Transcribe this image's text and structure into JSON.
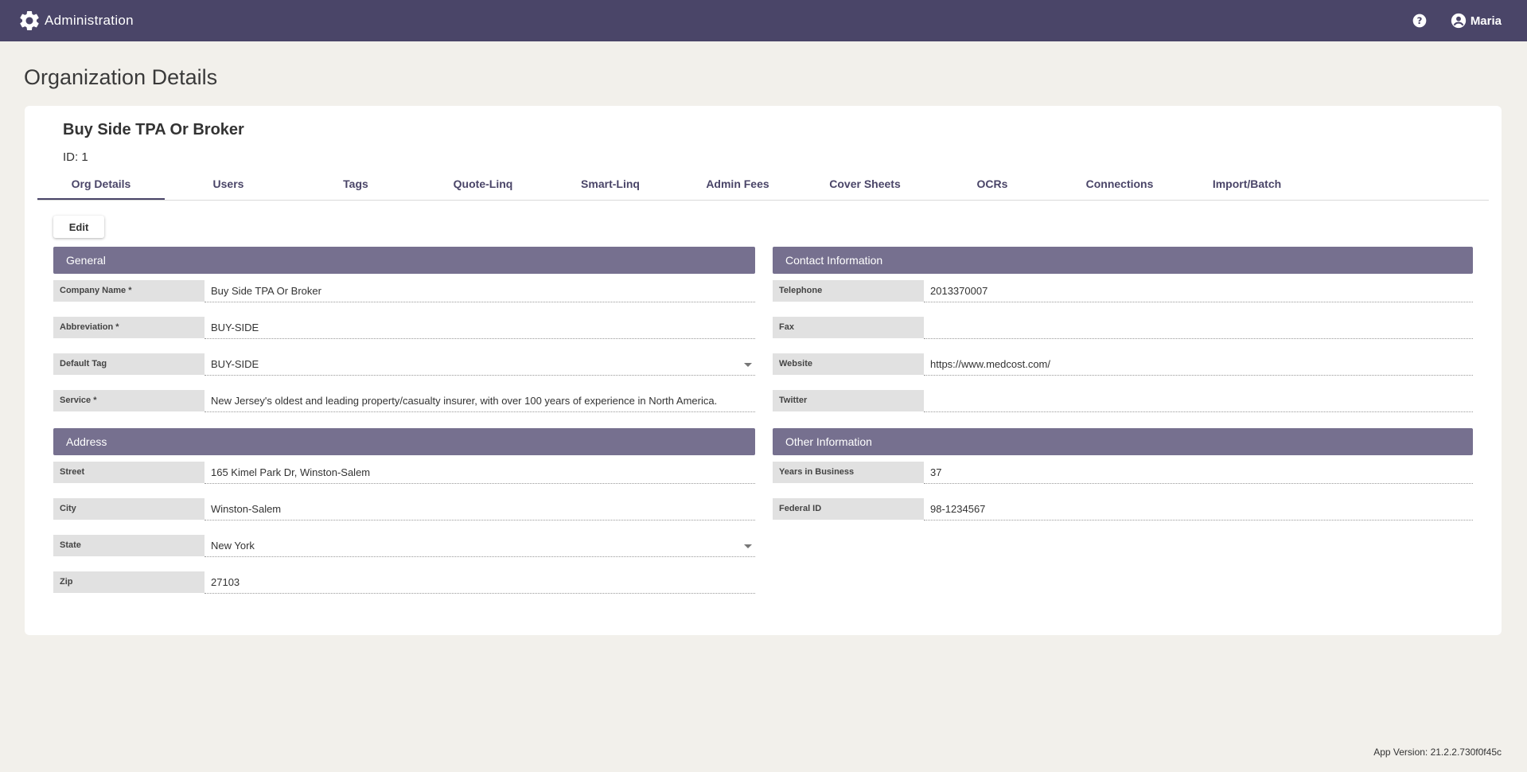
{
  "header": {
    "app_title": "Administration",
    "user_name": "Maria",
    "settings_icon": "gear-icon",
    "help_icon": "help-icon",
    "user_icon": "account-circle-icon",
    "bar_color": "#4a4568"
  },
  "page": {
    "title": "Organization Details",
    "org_name": "Buy Side TPA Or Broker",
    "id_label": "ID:",
    "id_value": "1"
  },
  "tabs": [
    {
      "label": "Org Details",
      "active": true
    },
    {
      "label": "Users"
    },
    {
      "label": "Tags"
    },
    {
      "label": "Quote-Linq"
    },
    {
      "label": "Smart-Linq"
    },
    {
      "label": "Admin Fees"
    },
    {
      "label": "Cover Sheets"
    },
    {
      "label": "OCRs"
    },
    {
      "label": "Connections"
    },
    {
      "label": "Import/Batch"
    }
  ],
  "edit_label": "Edit",
  "general": {
    "title": "General",
    "company_name": {
      "label": "Company Name *",
      "value": "Buy Side TPA Or Broker"
    },
    "abbreviation": {
      "label": "Abbreviation *",
      "value": "BUY-SIDE"
    },
    "default_tag": {
      "label": "Default Tag",
      "value": "BUY-SIDE"
    },
    "service": {
      "label": "Service *",
      "value": "New Jersey's oldest and leading property/casualty insurer, with over 100 years of experience in North America."
    }
  },
  "contact": {
    "title": "Contact Information",
    "telephone": {
      "label": "Telephone",
      "value": "2013370007"
    },
    "fax": {
      "label": "Fax",
      "value": ""
    },
    "website": {
      "label": "Website",
      "value": "https://www.medcost.com/"
    },
    "twitter": {
      "label": "Twitter",
      "value": ""
    }
  },
  "address": {
    "title": "Address",
    "street": {
      "label": "Street",
      "value": "165 Kimel Park Dr, Winston-Salem"
    },
    "city": {
      "label": "City",
      "value": "Winston-Salem"
    },
    "state": {
      "label": "State",
      "value": "New York"
    },
    "zip": {
      "label": "Zip",
      "value": "27103"
    }
  },
  "other": {
    "title": "Other Information",
    "years_in_business": {
      "label": "Years in Business",
      "value": "37"
    },
    "federal_id": {
      "label": "Federal ID",
      "value": "98-1234567"
    }
  },
  "footer": {
    "app_version": "App Version: 21.2.2.730f0f45c"
  }
}
